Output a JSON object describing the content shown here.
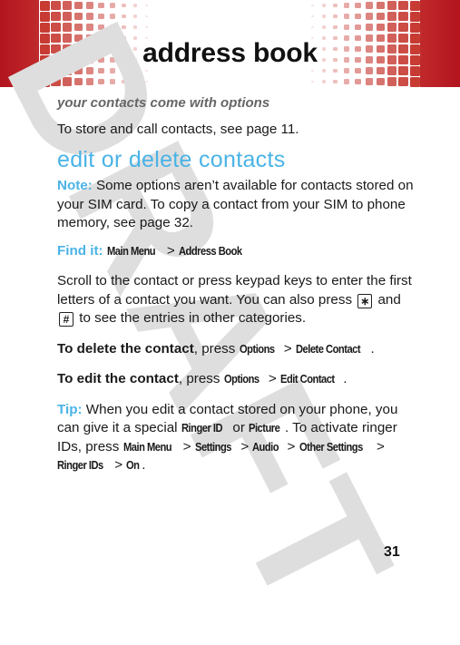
{
  "header": {
    "title": "address book",
    "accent_color": "#b3141e"
  },
  "subhead": "your contacts come with options",
  "intro": "To store and call contacts, see page 11.",
  "section": {
    "title": "edit or delete contacts",
    "title_color": "#4ab3e6",
    "note": {
      "label": "Note:",
      "text": " Some options aren’t available for contacts stored on your SIM card. To copy a contact from your SIM to phone memory, see page 32."
    },
    "find_it": {
      "label": "Find it:",
      "path": [
        "Main Menu",
        "Address Book"
      ],
      "separator": " > "
    },
    "scroll_text": {
      "before": "Scroll to the contact or press keypad keys to enter the first letters of a contact you want. You can also press ",
      "key1": "∗",
      "key1_name": "star-key",
      "middle": " and ",
      "key2": "#",
      "key2_name": "pound-key",
      "after": " to see the entries in other categories."
    },
    "delete": {
      "lead": "To delete the contact",
      "press": ", press ",
      "path": [
        "Options",
        "Delete Contact"
      ],
      "end": "."
    },
    "edit": {
      "lead": "To edit the contact",
      "press": ", press ",
      "path": [
        "Options",
        "Edit Contact"
      ],
      "end": "."
    },
    "tip": {
      "label": "Tip:",
      "text1": " When you edit a contact stored on your phone, you can give it a special ",
      "opt1": "Ringer ID",
      "or": " or ",
      "opt2": "Picture",
      "text2": ". To activate ringer IDs, press ",
      "path": [
        "Main Menu",
        "Settings",
        "Audio",
        "Other Settings",
        "Ringer IDs",
        "On"
      ],
      "end": "."
    }
  },
  "watermark": "DRAFT",
  "page_number": "31"
}
